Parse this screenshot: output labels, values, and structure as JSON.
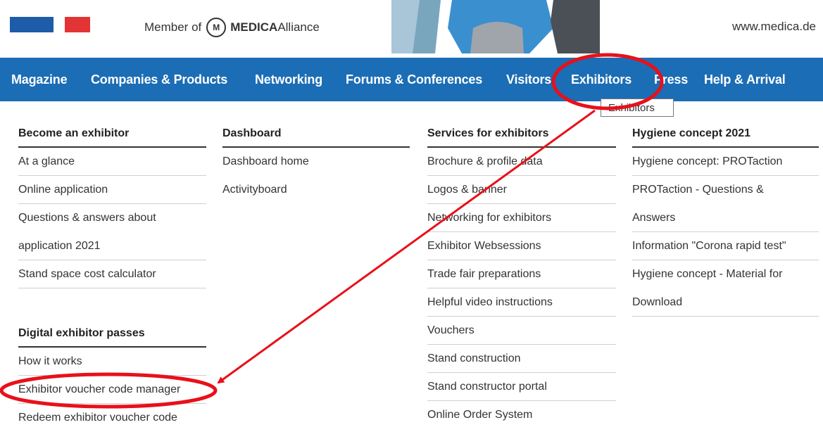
{
  "header": {
    "member_prefix": "Member of",
    "alliance_mark": "M",
    "alliance_brand": "MEDICA",
    "alliance_suffix": "Alliance",
    "site_url": "www.medica.de",
    "colors": {
      "flag_blue": "#1c5ca8",
      "flag_red": "#e23434"
    }
  },
  "nav": {
    "color": "#1b6db5",
    "items": [
      {
        "label": "Magazine"
      },
      {
        "label": "Companies & Products"
      },
      {
        "label": "Networking"
      },
      {
        "label": "Forums & Conferences"
      },
      {
        "label": "Visitors"
      },
      {
        "label": "Exhibitors"
      },
      {
        "label": "Press"
      },
      {
        "label": "Help & Arrival"
      }
    ]
  },
  "tooltip": {
    "text": "Exhibitors"
  },
  "menu": {
    "col1": {
      "head": "Become an exhibitor",
      "items": [
        "At a glance",
        "Online application",
        "Questions & answers about",
        "application 2021",
        "Stand space cost calculator"
      ],
      "head2": "Digital exhibitor passes",
      "items2": [
        "How it works",
        "Exhibitor voucher code manager",
        "Redeem exhibitor voucher code"
      ]
    },
    "col2": {
      "head": "Dashboard",
      "items": [
        "Dashboard home",
        "Activityboard"
      ]
    },
    "col3": {
      "head": "Services for exhibitors",
      "items": [
        "Brochure & profile data",
        "Logos & banner",
        "Networking for exhibitors",
        "Exhibitor Websessions",
        "Trade fair preparations",
        "Helpful video instructions",
        "Vouchers",
        "Stand construction",
        "Stand constructor portal",
        "Online Order System"
      ]
    },
    "col4": {
      "head": "Hygiene concept 2021",
      "items": [
        "Hygiene concept: PROTaction",
        "PROTaction - Questions &",
        "Answers",
        "Information \"Corona rapid test\"",
        "Hygiene concept - Material for",
        "Download"
      ]
    }
  },
  "annotation": {
    "color": "#e8101a"
  }
}
